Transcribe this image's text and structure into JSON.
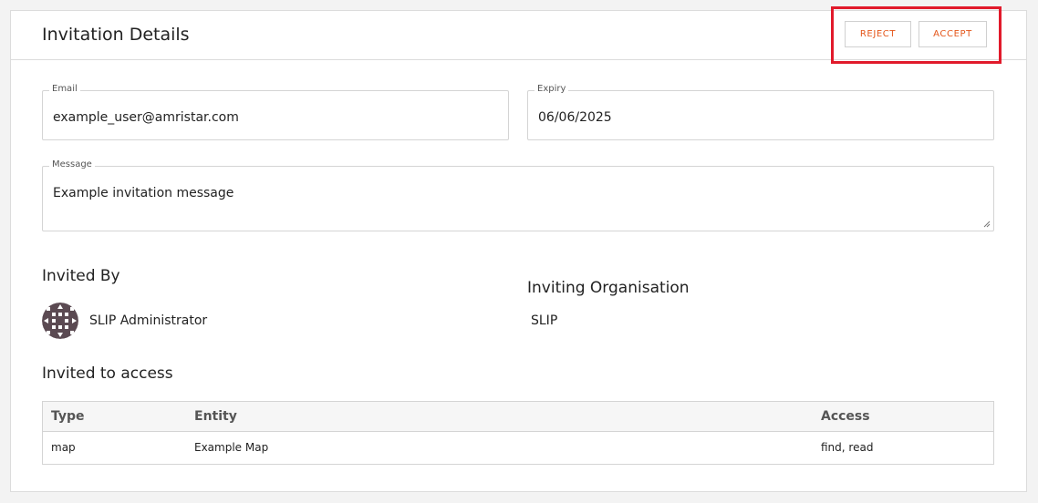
{
  "header": {
    "title": "Invitation Details",
    "reject_label": "REJECT",
    "accept_label": "ACCEPT",
    "highlight_color": "#e11a2b",
    "button_text_color": "#e4561a"
  },
  "form": {
    "email": {
      "label": "Email",
      "value": "example_user@amristar.com"
    },
    "expiry": {
      "label": "Expiry",
      "value": "06/06/2025"
    },
    "message": {
      "label": "Message",
      "value": "Example invitation message"
    }
  },
  "invited_by": {
    "heading": "Invited By",
    "name": "SLIP Administrator",
    "avatar_icon": "geometric-avatar-icon"
  },
  "inviting_org": {
    "heading": "Inviting Organisation",
    "name": "SLIP"
  },
  "access": {
    "heading": "Invited to access",
    "columns": [
      "Type",
      "Entity",
      "Access"
    ],
    "rows": [
      {
        "type": "map",
        "entity": "Example Map",
        "access": "find, read"
      }
    ]
  }
}
